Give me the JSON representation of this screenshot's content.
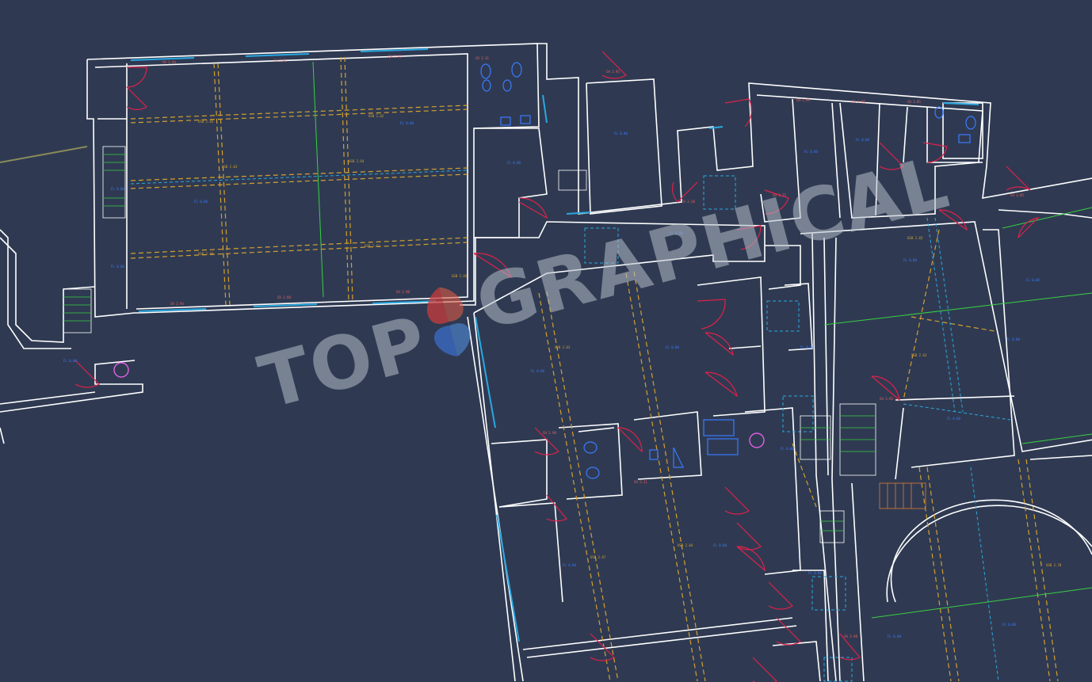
{
  "colors": {
    "background": "#2f3a52",
    "walls": "#ffffff",
    "doors": "#e0204a",
    "beams": "#d4a030",
    "ducts": "#2aa8e0",
    "stairs": "#38d040",
    "labels_red": "#f06060",
    "labels_blue": "#3a7aff"
  },
  "watermark": {
    "part1": "TOP",
    "part2": "GRAPHICAL"
  },
  "icons": [
    "wc-icon",
    "sink-icon",
    "shower-icon",
    "circular-column-icon",
    "stair-icon",
    "door-swing-icon"
  ]
}
